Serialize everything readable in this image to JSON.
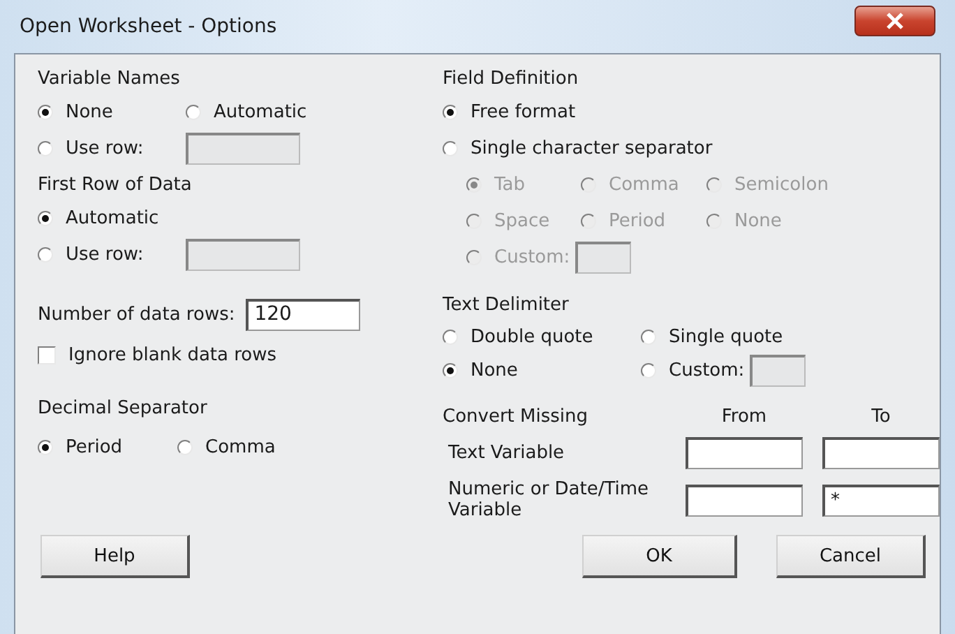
{
  "window": {
    "title": "Open Worksheet - Options"
  },
  "variable_names": {
    "label": "Variable Names",
    "options": [
      {
        "label": "None",
        "selected": true
      },
      {
        "label": "Automatic",
        "selected": false
      },
      {
        "label": "Use row:",
        "selected": false,
        "field": {
          "disabled": true
        }
      }
    ]
  },
  "first_row_of_data": {
    "label": "First Row of Data",
    "options": [
      {
        "label": "Automatic",
        "selected": true
      },
      {
        "label": "Use row:",
        "selected": false,
        "field": {
          "disabled": true
        }
      }
    ]
  },
  "number_of_data_rows": {
    "label": "Number of data rows:",
    "value": "120"
  },
  "ignore_blank_rows": {
    "label": "Ignore blank data rows",
    "checked": false
  },
  "decimal_separator": {
    "label": "Decimal Separator",
    "options": [
      {
        "label": "Period",
        "selected": true
      },
      {
        "label": "Comma",
        "selected": false
      }
    ]
  },
  "field_definition": {
    "label": "Field Definition",
    "options": [
      {
        "label": "Free format",
        "selected": true
      },
      {
        "label": "Single character separator",
        "selected": false
      }
    ],
    "separator": {
      "disabled": true,
      "options": [
        {
          "label": "Tab",
          "selected": true
        },
        {
          "label": "Comma",
          "selected": false
        },
        {
          "label": "Semicolon",
          "selected": false
        },
        {
          "label": "Space",
          "selected": false
        },
        {
          "label": "Period",
          "selected": false
        },
        {
          "label": "None",
          "selected": false
        },
        {
          "label": "Custom:",
          "selected": false,
          "field": {
            "disabled": true
          }
        }
      ]
    }
  },
  "text_delimiter": {
    "label": "Text Delimiter",
    "options": [
      {
        "label": "Double quote",
        "selected": false
      },
      {
        "label": "Single quote",
        "selected": false
      },
      {
        "label": "None",
        "selected": true
      },
      {
        "label": "Custom:",
        "selected": false,
        "field": {
          "disabled": true
        }
      }
    ]
  },
  "convert_missing": {
    "label": "Convert Missing",
    "columns": [
      "From",
      "To"
    ],
    "rows": [
      {
        "label": "Text Variable",
        "from": "",
        "to": ""
      },
      {
        "label": "Numeric or Date/Time Variable",
        "from": "",
        "to": "*"
      }
    ]
  },
  "buttons": [
    "Help",
    "OK",
    "Cancel"
  ]
}
